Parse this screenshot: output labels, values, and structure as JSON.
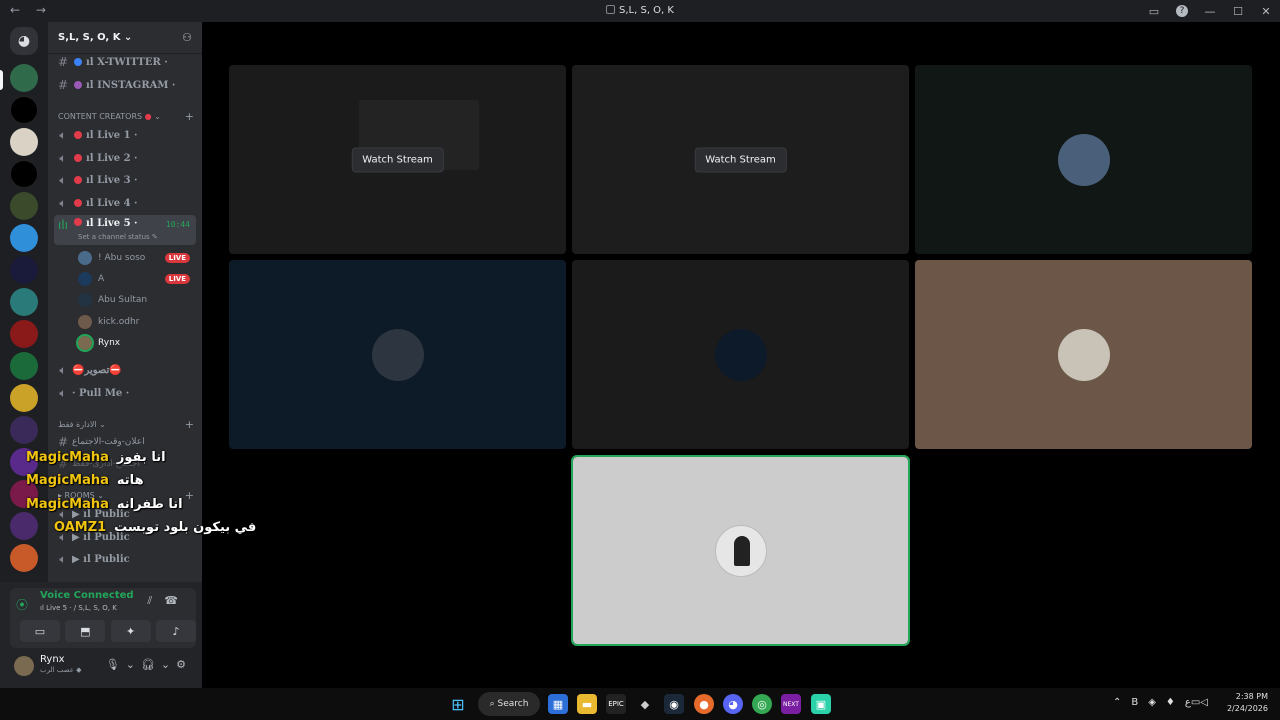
{
  "window": {
    "title": "S,L, S, O, K",
    "nav": "← →",
    "controls": [
      "▭",
      "?",
      "—",
      "☐",
      "✕"
    ]
  },
  "server": {
    "name": "S,L, S, O, K ⌄",
    "add_user_icon": "add-user-icon"
  },
  "channels": {
    "text": [
      {
        "name": "ıl X-TWITTER ·",
        "color": "#3ba55c"
      },
      {
        "name": "ıl INSTAGRAM ·",
        "color": "#9b59b6"
      }
    ],
    "category_creators": "CONTENT CREATORS",
    "voice": [
      {
        "name": "ıl Live 1 ·"
      },
      {
        "name": "ıl Live 2 ·"
      },
      {
        "name": "ıl Live 3 ·"
      },
      {
        "name": "ıl Live 4 ·"
      }
    ],
    "active": {
      "name": "ıl Live 5 ·",
      "timer": "10:44",
      "status": "Set a channel status ✎"
    },
    "users": [
      {
        "name": "! Abu soso",
        "live": "LIVE",
        "color": "#4a6b8a"
      },
      {
        "name": "A",
        "live": "LIVE",
        "color": "#1c3a5c"
      },
      {
        "name": "Abu Sultan",
        "live": "",
        "color": "#223344"
      },
      {
        "name": "kick.odhr",
        "live": "",
        "color": "#6d5a4a"
      },
      {
        "name": "Rynx",
        "live": "",
        "color": "#7a6a4f"
      }
    ],
    "more_voice": [
      {
        "name": "⛔تصوير⛔"
      },
      {
        "name": "· Pull Me ·"
      }
    ],
    "category_admin": "الادارة فقط ⌄",
    "admin_text": "اعلان-وقت-الاجتماع",
    "admin_text2": "اجتماع-ادارى-فقط",
    "category_rooms": "▸ ROOMS ⌄",
    "rooms": [
      {
        "name": "▶ ıl Public"
      },
      {
        "name": "▶ ıl Public"
      },
      {
        "name": "▶ ıl Public"
      }
    ]
  },
  "overlay_messages": [
    {
      "name": "MagicMaha",
      "msg": "انا بفوز"
    },
    {
      "name": "MagicMaha",
      "msg": "هاته"
    },
    {
      "name": "MagicMaha",
      "msg": "انا طفرانه"
    },
    {
      "name": "OAMZ1",
      "msg": "في بيكون بلود توبست"
    }
  ],
  "voice_panel": {
    "status": "Voice Connected",
    "channel": "ıl Live 5 · / S,L, S, O, K",
    "buttons": [
      "camera-off-icon",
      "screen-share-icon",
      "activities-icon",
      "soundboard-icon"
    ]
  },
  "me": {
    "name": "Rynx",
    "status": "عصب الرب ◆"
  },
  "tiles": [
    {
      "label": "Watch Stream",
      "bg": "#1b1b1b",
      "avatar_color": ""
    },
    {
      "label": "Watch Stream",
      "bg": "#1d1d1e",
      "avatar_color": ""
    },
    {
      "label": "",
      "bg": "#111715",
      "avatar_color": "#4a5f7a"
    },
    {
      "label": "",
      "bg": "#0d1a27",
      "avatar_color": "#2c3540"
    },
    {
      "label": "",
      "bg": "#1b1b1c",
      "avatar_color": "#0c1a2a"
    },
    {
      "label": "",
      "bg": "#6b5647",
      "avatar_color": "#c9c2b6"
    },
    {
      "label": "",
      "bg": "#cccccc",
      "avatar_color": "#8a8a8a"
    }
  ],
  "taskbar": {
    "search": "Search",
    "time": "2:38 PM",
    "date": "2/24/2026",
    "lang": "ع"
  }
}
